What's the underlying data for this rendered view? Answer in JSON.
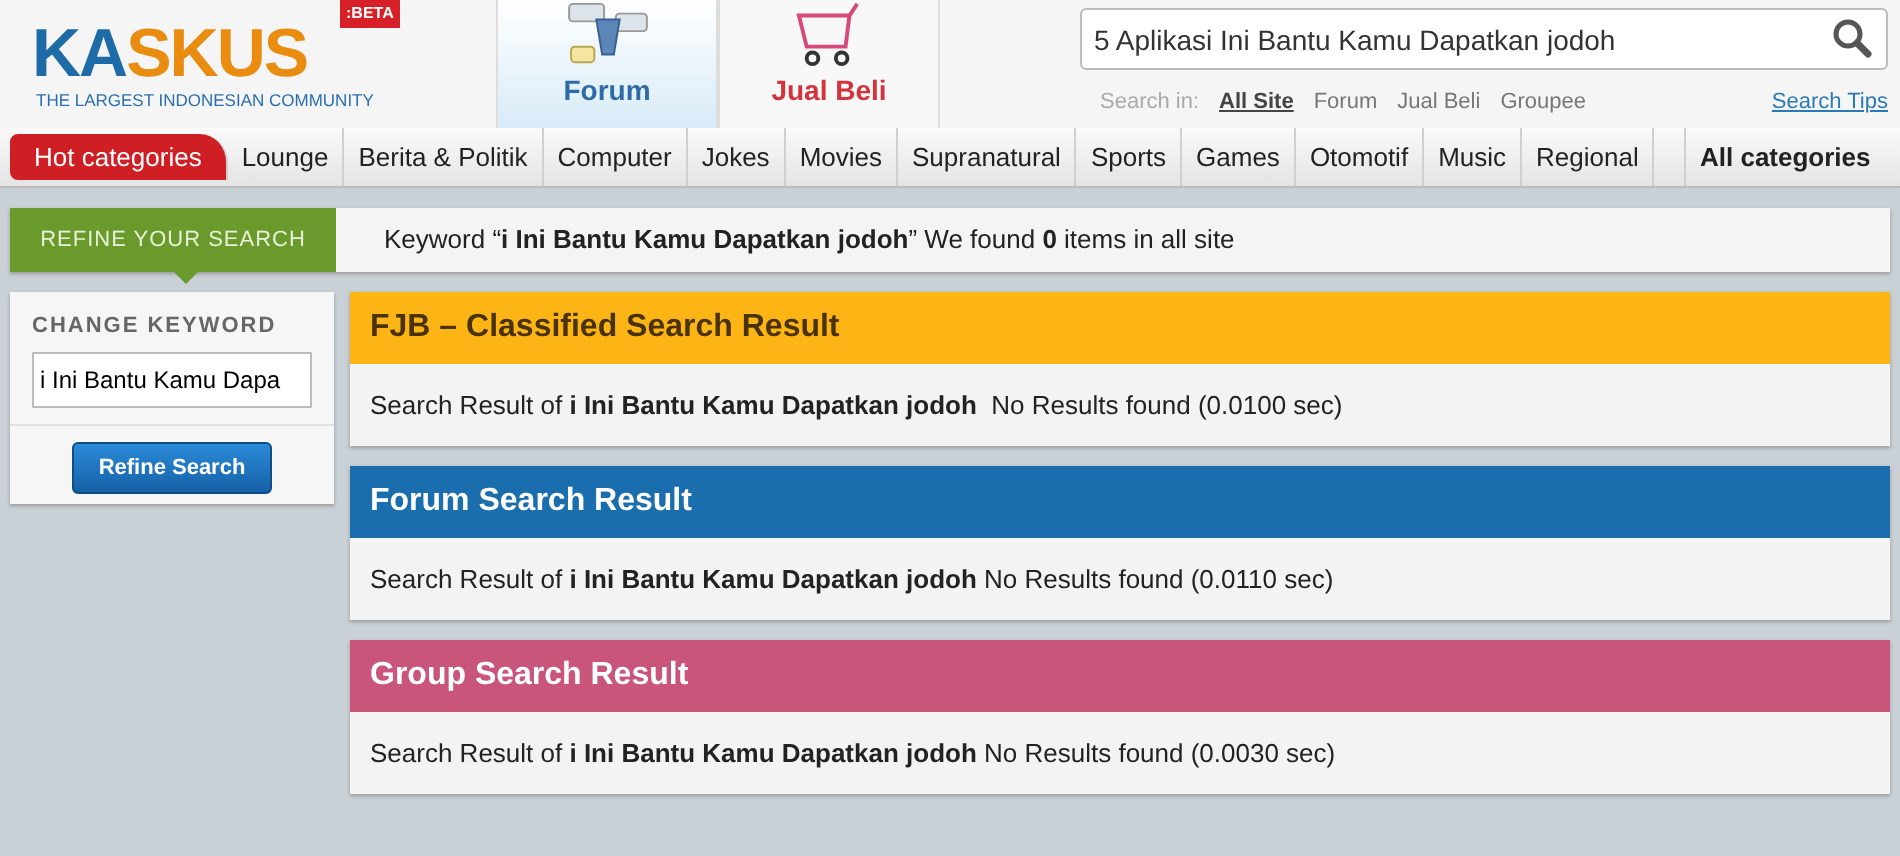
{
  "logo": {
    "name": "KASKUS",
    "badge": ":BETA",
    "tagline": "THE LARGEST INDONESIAN COMMUNITY"
  },
  "header_tabs": [
    {
      "label": "Forum",
      "kind": "forum",
      "selected": true
    },
    {
      "label": "Jual Beli",
      "kind": "cart",
      "selected": false
    }
  ],
  "search": {
    "value": "5 Aplikasi Ini Bantu Kamu Dapatkan jodoh",
    "scope_label": "Search in:",
    "scopes": [
      {
        "label": "All Site",
        "selected": true
      },
      {
        "label": "Forum",
        "selected": false
      },
      {
        "label": "Jual Beli",
        "selected": false
      },
      {
        "label": "Groupee",
        "selected": false
      }
    ],
    "tips": "Search Tips"
  },
  "categories": [
    {
      "label": "Hot categories",
      "kind": "hot"
    },
    {
      "label": "Lounge",
      "kind": "plain"
    },
    {
      "label": "Berita & Politik",
      "kind": "plain"
    },
    {
      "label": "Computer",
      "kind": "plain"
    },
    {
      "label": "Jokes",
      "kind": "plain"
    },
    {
      "label": "Movies",
      "kind": "plain"
    },
    {
      "label": "Supranatural",
      "kind": "plain"
    },
    {
      "label": "Sports",
      "kind": "plain"
    },
    {
      "label": "Games",
      "kind": "plain"
    },
    {
      "label": "Otomotif",
      "kind": "plain"
    },
    {
      "label": "Music",
      "kind": "plain"
    },
    {
      "label": "Regional",
      "kind": "plain"
    },
    {
      "label": "All categories",
      "kind": "all"
    }
  ],
  "refine_tab": "REFINE YOUR SEARCH",
  "summary": "Keyword “**i Ini Bantu Kamu Dapatkan jodoh**” We found **0** items in all site",
  "sidebar": {
    "heading": "CHANGE KEYWORD",
    "keyword": "i Ini Bantu Kamu Dapa",
    "button": "Refine Search"
  },
  "results": [
    {
      "title": "FJB – Classified Search Result",
      "color": "#fdb515",
      "text": "Search Result of **i Ini Bantu Kamu Dapatkan jodoh**  No Results found (0.0100 sec)"
    },
    {
      "title": "Forum Search Result",
      "color": "#1a6eae",
      "text": "Search Result of **i Ini Bantu Kamu Dapatkan jodoh** No Results found (0.0110 sec)"
    },
    {
      "title": "Group Search Result",
      "color": "#c9557a",
      "text": "Search Result of **i Ini Bantu Kamu Dapatkan jodoh** No Results found (0.0030 sec)"
    }
  ]
}
